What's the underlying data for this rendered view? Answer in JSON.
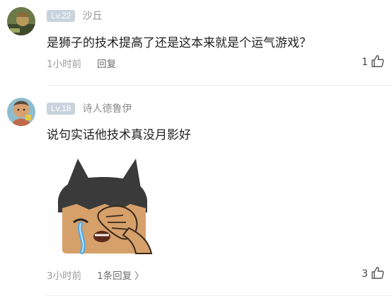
{
  "comments": [
    {
      "level": "Lv.22",
      "username": "沙丘",
      "text": "是狮子的技术提高了还是这本来就是个运气游戏？",
      "time": "1小时前",
      "reply_label": "回复",
      "likes": "1"
    },
    {
      "level": "Lv.18",
      "username": "诗人德鲁伊",
      "text": "说句实话他技术真没月影好",
      "time": "3小时前",
      "reply_label": "1条回复",
      "reply_chevron": "〉",
      "likes": "3"
    }
  ],
  "icons": {
    "like": "thumbs-up-icon",
    "chevron": "chevron-right-icon",
    "sticker": "crying-cat-sticker"
  },
  "colors": {
    "level_badge": "#c9d3dd",
    "username": "#8c8c8c",
    "meta": "#9a9a9a"
  }
}
